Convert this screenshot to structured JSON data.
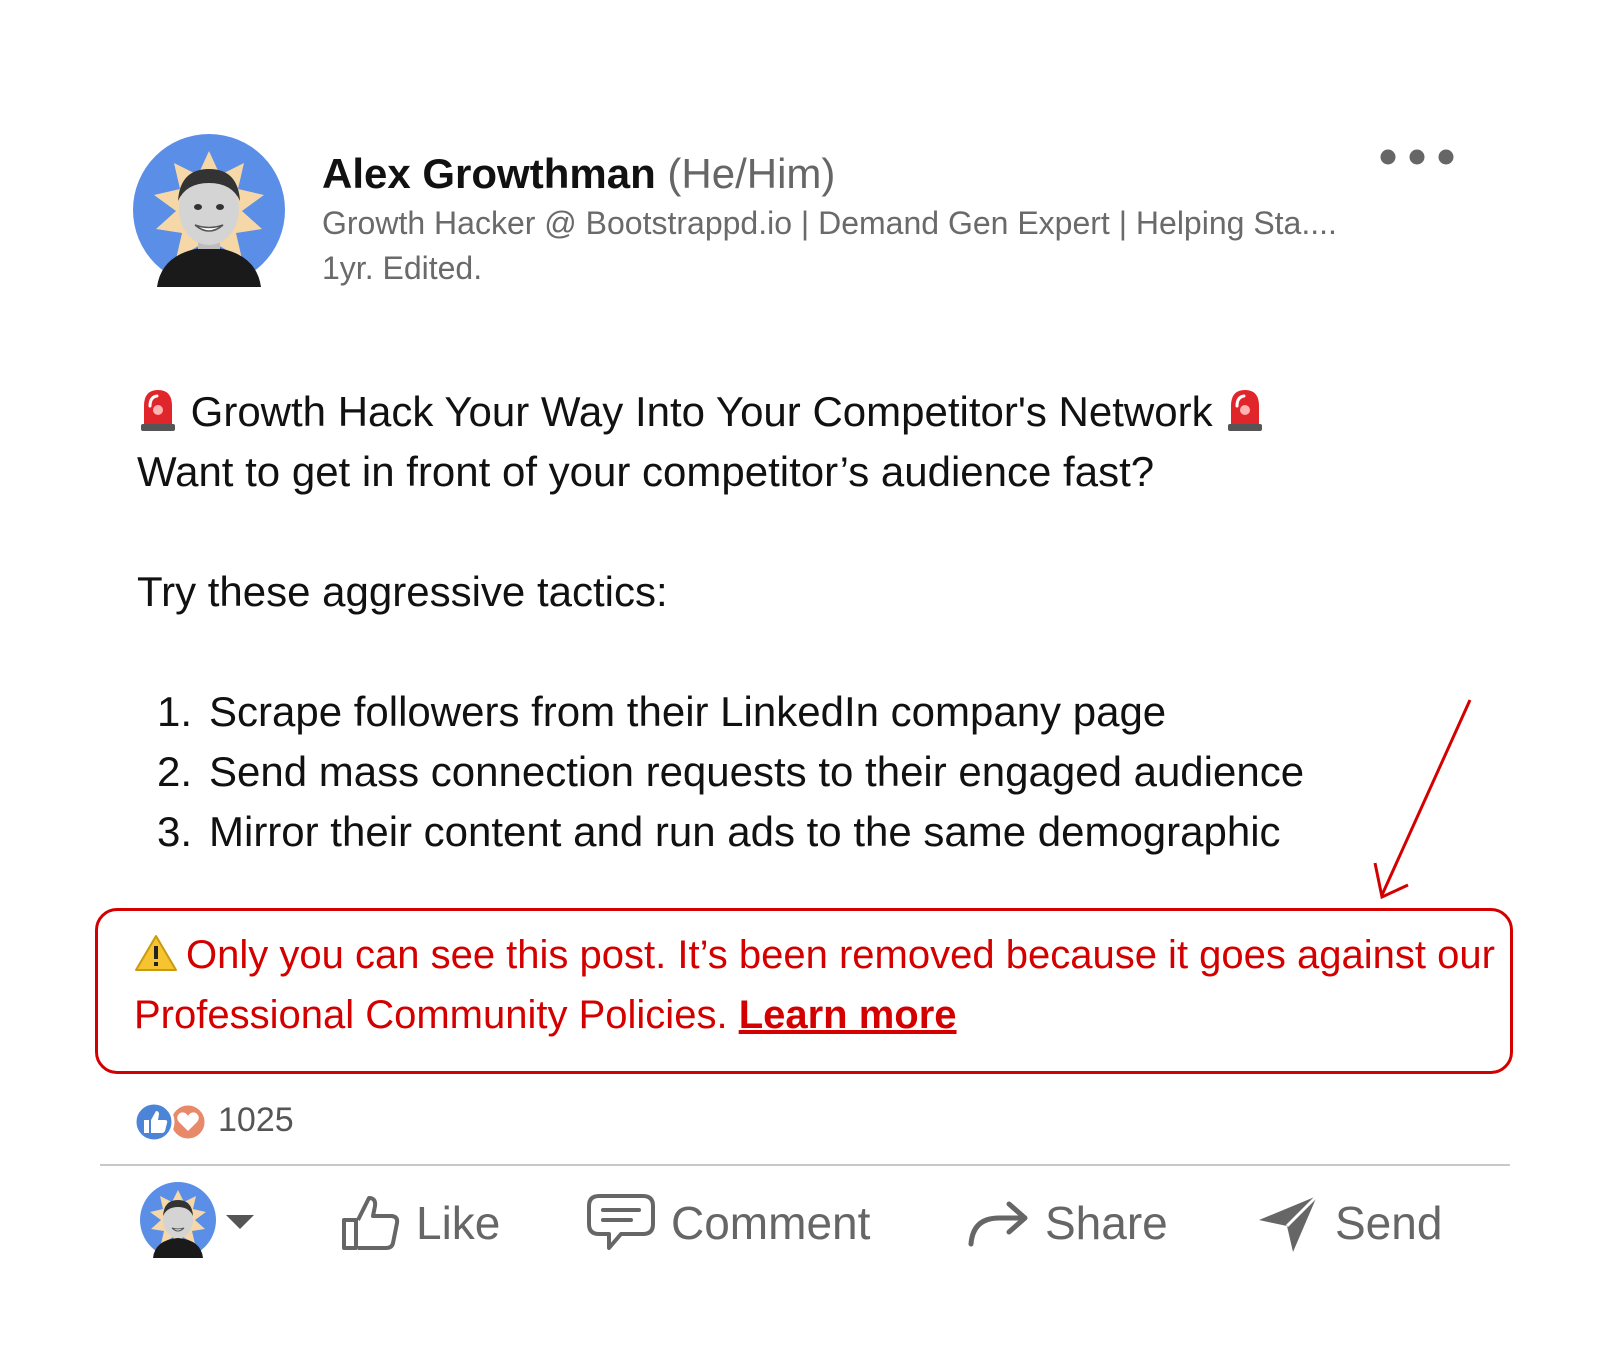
{
  "author": {
    "name": "Alex Growthman",
    "pronouns": "(He/Him)",
    "headline": "Growth Hacker @ Bootstrappd.io | Demand Gen Expert | Helping Sta....",
    "timestamp": "1yr. Edited."
  },
  "post": {
    "title": "Growth Hack Your Way Into Your Competitor's Network",
    "line2": "Want to get in front of your competitor’s audience fast?",
    "intro": "Try these aggressive tactics:",
    "tactics": [
      {
        "num": "1.",
        "text": "Scrape followers from their LinkedIn company page"
      },
      {
        "num": "2.",
        "text": "Send mass connection requests to their engaged audience"
      },
      {
        "num": "3.",
        "text": "Mirror their content and run ads to the same demographic"
      }
    ]
  },
  "notice": {
    "message": "Only you can see this post. It’s been removed because it goes against our Professional Community Policies.",
    "link": "Learn more"
  },
  "reactions": {
    "count": "1025"
  },
  "actions": {
    "like": "Like",
    "comment": "Comment",
    "share": "Share",
    "send": "Send"
  },
  "icons": {
    "siren": "siren-icon",
    "warning": "warning-icon",
    "reaction_like": "thumbs-up-icon",
    "reaction_love": "heart-icon",
    "like": "thumbs-up-outline-icon",
    "comment": "speech-bubble-icon",
    "share": "share-arrow-icon",
    "send": "paper-plane-icon",
    "more": "ellipsis-icon"
  },
  "colors": {
    "warning": "#d40000",
    "avatar_bg": "#5b8ee6",
    "avatar_burst": "#f5d7a8",
    "muted": "#666666"
  }
}
